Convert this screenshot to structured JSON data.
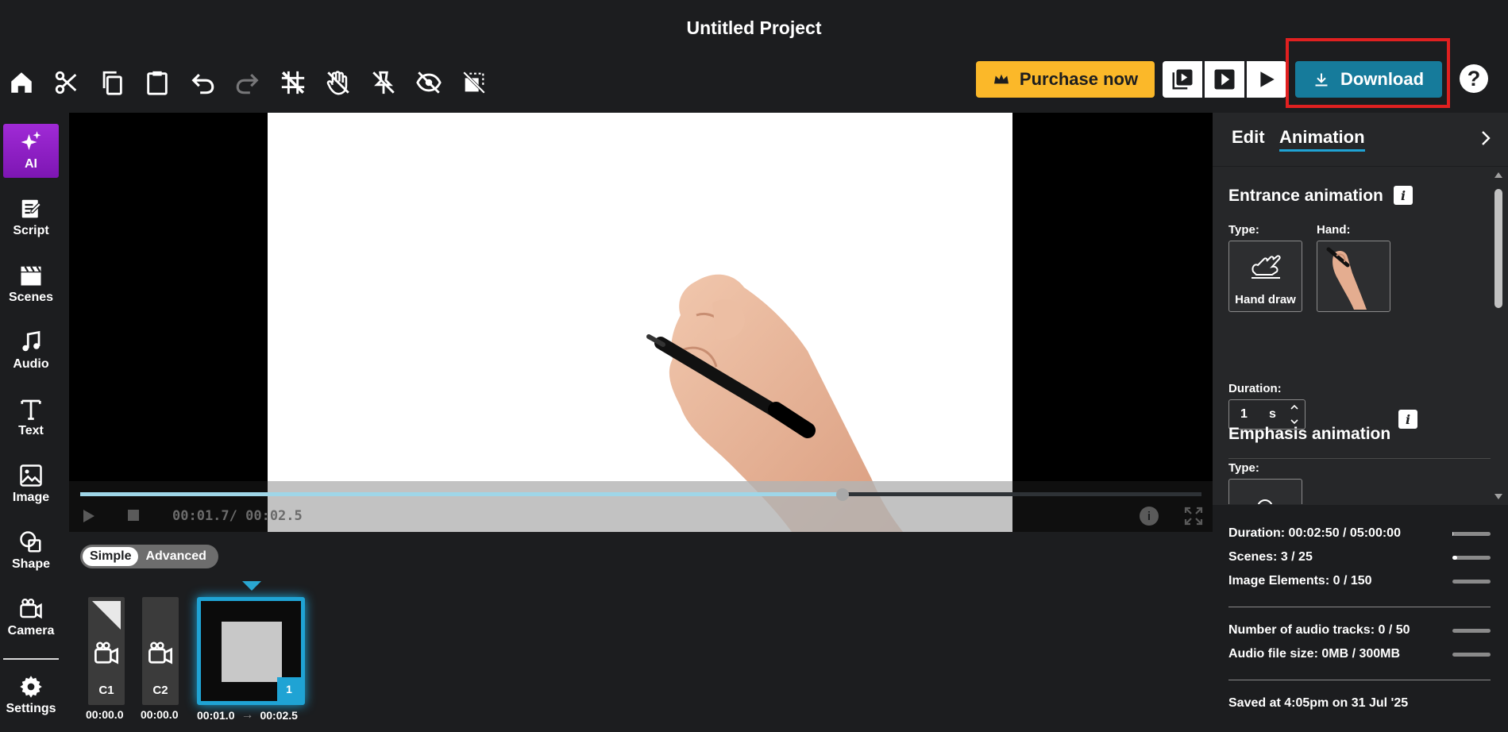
{
  "project": {
    "title": "Untitled Project"
  },
  "toolbar": {
    "purchase_label": "Purchase now",
    "download_label": "Download",
    "help_label": "?"
  },
  "sidebar": {
    "items": [
      {
        "label": "AI",
        "icon": "sparkle-icon"
      },
      {
        "label": "Script",
        "icon": "script-icon"
      },
      {
        "label": "Scenes",
        "icon": "clapperboard-icon"
      },
      {
        "label": "Audio",
        "icon": "music-note-icon"
      },
      {
        "label": "Text",
        "icon": "text-icon"
      },
      {
        "label": "Image",
        "icon": "image-icon"
      },
      {
        "label": "Shape",
        "icon": "shape-icon"
      },
      {
        "label": "Camera",
        "icon": "camera-icon"
      },
      {
        "label": "Settings",
        "icon": "gear-icon"
      }
    ]
  },
  "player": {
    "current_time": "00:01.7",
    "total_time": "00:02.5",
    "time_display": "00:01.7/ 00:02.5",
    "progress": 0.68
  },
  "timeline": {
    "modes": [
      "Simple",
      "Advanced"
    ],
    "active_mode": "Simple",
    "cameras": [
      {
        "label": "C1",
        "time": "00:00.0"
      },
      {
        "label": "C2",
        "time": "00:00.0"
      }
    ],
    "scene": {
      "number": "1",
      "start": "00:01.0",
      "end": "00:02.5",
      "arrow": "→"
    }
  },
  "panel": {
    "tabs": [
      "Edit",
      "Animation"
    ],
    "active_tab": "Animation",
    "entrance": {
      "title": "Entrance animation",
      "type_label": "Type:",
      "hand_label": "Hand:",
      "type_value": "Hand draw",
      "duration_label": "Duration:",
      "duration_value": "1",
      "duration_unit": "s"
    },
    "emphasis": {
      "title": "Emphasis animation",
      "type_label": "Type:"
    },
    "info_glyph": "i"
  },
  "stats": {
    "duration": {
      "label": "Duration: 00:02:50 / 05:00:00",
      "fraction": 0.01
    },
    "scenes": {
      "label": "Scenes: 3 / 25",
      "fraction": 0.12
    },
    "image_elements": {
      "label": "Image Elements: 0 / 150",
      "fraction": 0
    },
    "audio_tracks": {
      "label": "Number of audio tracks: 0 / 50",
      "fraction": 0
    },
    "audio_size": {
      "label": "Audio file size: 0MB / 300MB",
      "fraction": 0
    },
    "saved": "Saved at 4:05pm on 31 Jul '25"
  },
  "colors": {
    "accent": "#1fa3d4",
    "download": "#167b9b",
    "purchase": "#fbb829",
    "ai": "#a02ad6",
    "highlight": "#e02020"
  }
}
